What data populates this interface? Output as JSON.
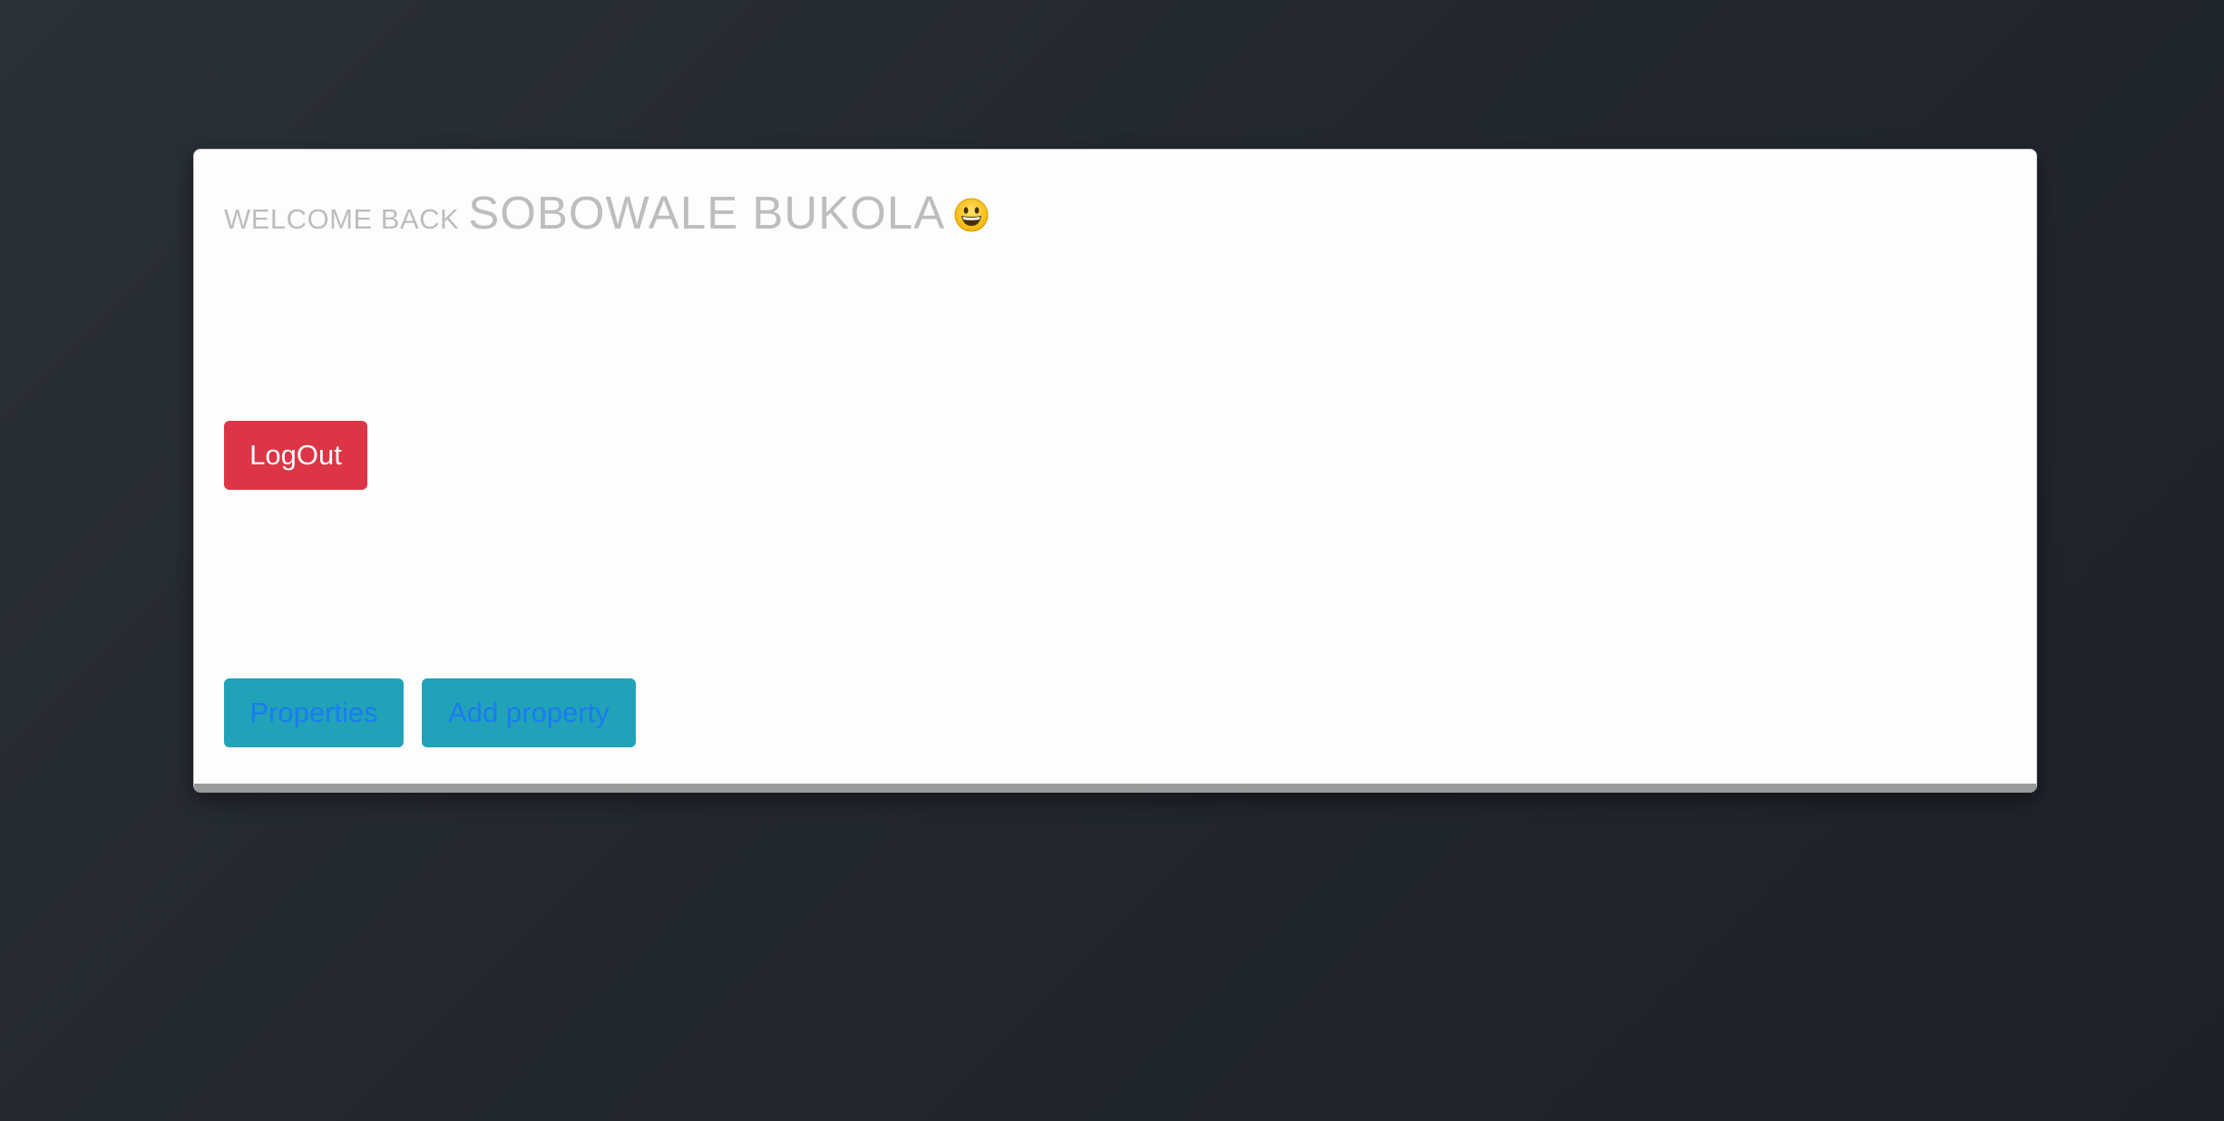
{
  "welcome": {
    "prefix": "WELCOME BACK",
    "name": "SOBOWALE BUKOLA",
    "emoji_icon": "grinning-face-icon"
  },
  "actions": {
    "logout_label": "LogOut",
    "properties_label": "Properties",
    "add_property_label": "Add property"
  },
  "colors": {
    "background": "#23282f",
    "card": "#fdfdfd",
    "welcome_text": "#bdbdbd",
    "logout_bg": "#dc3545",
    "nav_button_bg": "#22a2b8",
    "nav_button_text": "#1a7bf0"
  }
}
